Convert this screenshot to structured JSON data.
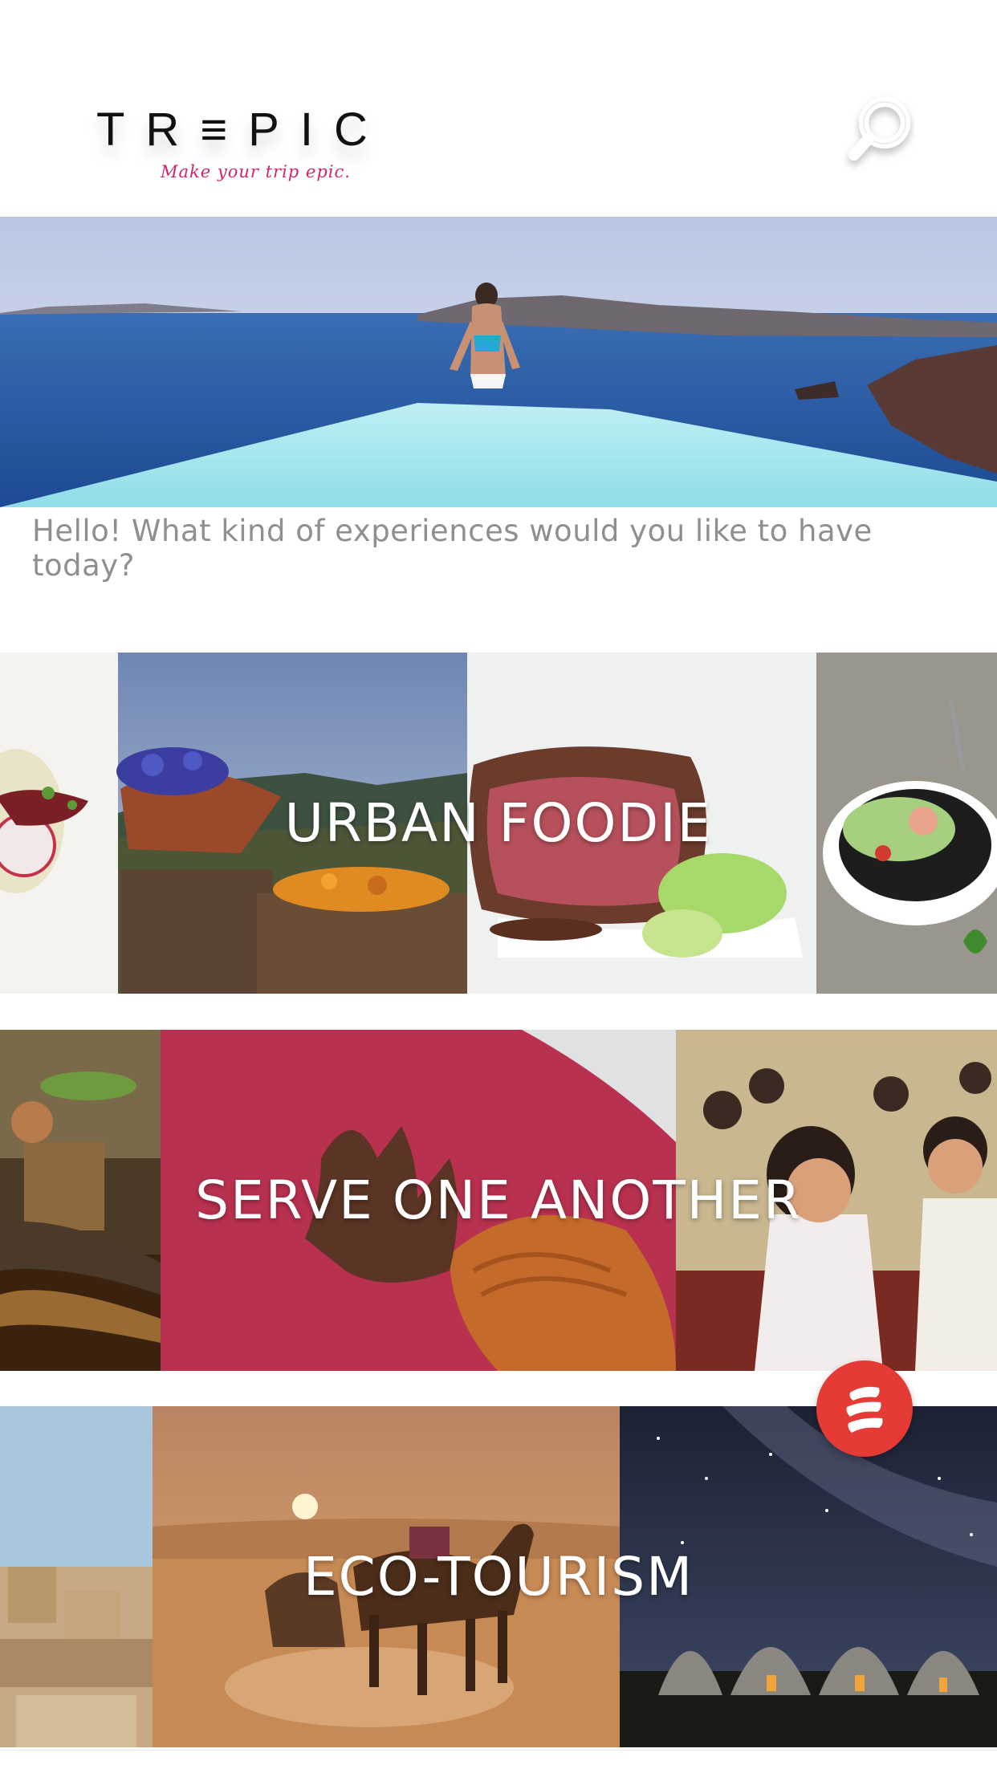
{
  "app": {
    "logo_text": "TR≡PIC",
    "tagline": "Make your trip epic."
  },
  "header": {
    "search_icon": "search-icon"
  },
  "hero": {
    "greeting": "Hello! What kind of experiences would you like to have today?"
  },
  "categories": [
    {
      "title": "URBAN FOODIE"
    },
    {
      "title": "SERVE ONE ANOTHER"
    },
    {
      "title": "ECO-TOURISM"
    }
  ],
  "fab": {
    "icon": "menu-stripes-icon",
    "color": "#e53a36"
  },
  "colors": {
    "brand_accent": "#d2246f",
    "fab": "#e53a36",
    "greeting_text": "#8f8f8f"
  }
}
